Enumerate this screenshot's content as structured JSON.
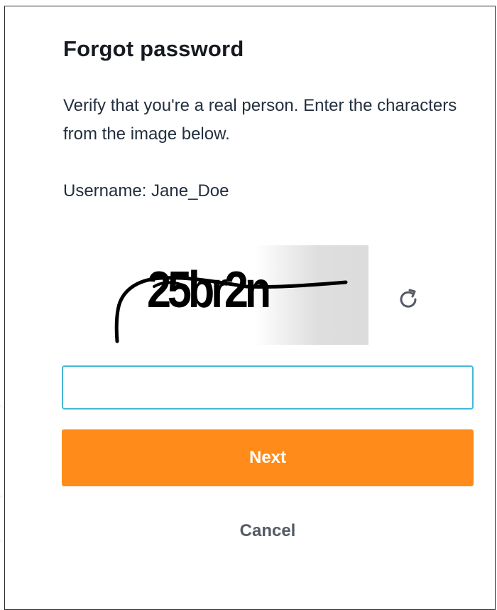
{
  "dialog": {
    "title": "Forgot password",
    "description": "Verify that you're a real person. Enter the characters from the image below.",
    "username_label": "Username:",
    "username_value": "Jane_Doe"
  },
  "captcha": {
    "image_text": "25br2n",
    "refresh_icon": "refresh-icon",
    "input_value": "",
    "input_placeholder": ""
  },
  "actions": {
    "next_label": "Next",
    "cancel_label": "Cancel"
  },
  "colors": {
    "primary_button": "#ff8c1a",
    "input_focus_border": "#44b9d6",
    "title_text": "#16191f",
    "body_text": "#232f3e",
    "cancel_text": "#545b64"
  }
}
